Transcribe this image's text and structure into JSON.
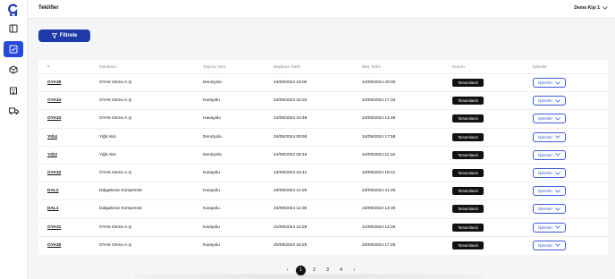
{
  "header": {
    "title": "Teklifler",
    "user": "Demo Kişi 1"
  },
  "toolbar": {
    "filter_label": "Filtrele"
  },
  "table": {
    "columns": [
      "#",
      "Gönderici",
      "Taşıma Türü",
      "Başlama Tarihi",
      "Bitiş Tarihi",
      "Durum",
      "İşlemler"
    ],
    "rows": [
      {
        "id": "OYA35",
        "sender": "OYAK Demo A.Ş.",
        "type": "Denizyolu",
        "start": "24/09/2024 18:00",
        "end": "24/09/2024 20:00",
        "status": "Tamamlandı",
        "action": "İşlemler"
      },
      {
        "id": "OYA34",
        "sender": "OYAK Demo A.Ş.",
        "type": "Karayolu",
        "start": "24/09/2024 15:33",
        "end": "24/09/2024 17:33",
        "status": "Tamamlandı",
        "action": "İşlemler"
      },
      {
        "id": "OYA33",
        "sender": "OYAK Demo A.Ş.",
        "type": "Havayolu",
        "start": "24/09/2024 10:48",
        "end": "24/09/2024 14:48",
        "status": "Tamamlandı",
        "action": "İşlemler"
      },
      {
        "id": "YIĞ4",
        "sender": "Yiğit Akü",
        "type": "Denizyolu",
        "start": "24/09/2024 09:58",
        "end": "24/09/2024 17:58",
        "status": "Tamamlandı",
        "action": "İşlemler"
      },
      {
        "id": "YIĞ3",
        "sender": "Yiğit Akü",
        "type": "Denizyolu",
        "start": "24/09/2024 09:16",
        "end": "24/09/2024 11:16",
        "status": "Tamamlandı",
        "action": "İşlemler"
      },
      {
        "id": "OYA32",
        "sender": "OYAK Demo A.Ş.",
        "type": "Karayolu",
        "start": "23/09/2024 16:41",
        "end": "23/09/2024 18:41",
        "status": "Tamamlandı",
        "action": "İşlemler"
      },
      {
        "id": "DAL2",
        "sender": "Dalgakıran Kompresör",
        "type": "Karayolu",
        "start": "23/09/2024 12:26",
        "end": "23/09/2024 21:26",
        "status": "Tamamlandı",
        "action": "İşlemler"
      },
      {
        "id": "DAL1",
        "sender": "Dalgakıran Kompresör",
        "type": "Karayolu",
        "start": "23/09/2024 12:30",
        "end": "23/09/2024 14:30",
        "status": "Tamamlandı",
        "action": "İşlemler"
      },
      {
        "id": "OYA31",
        "sender": "OYAK Demo A.Ş.",
        "type": "Karayolu",
        "start": "21/09/2024 12:28",
        "end": "21/09/2024 14:28",
        "status": "Tamamlandı",
        "action": "İşlemler"
      },
      {
        "id": "OYA30",
        "sender": "OYAK Demo A.Ş.",
        "type": "Karayolu",
        "start": "20/09/2024 15:25",
        "end": "20/09/2024 17:25",
        "status": "Tamamlandı",
        "action": "İşlemler"
      }
    ]
  },
  "pagination": {
    "pages": [
      "1",
      "2",
      "3",
      "4"
    ],
    "current": "1"
  },
  "colors": {
    "accent": "#2549d8",
    "button": "#1f3aa8",
    "status_bg": "#111111"
  }
}
